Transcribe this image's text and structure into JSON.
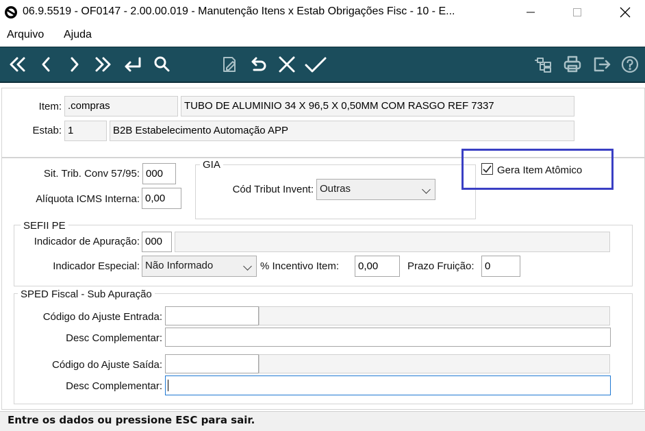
{
  "window": {
    "title": "06.9.5519 - OF0147 - 2.00.00.019 - Manutenção Itens x Estab Obrigações Fisc - 10 - E..."
  },
  "menu": {
    "items": [
      "Arquivo",
      "Ajuda"
    ]
  },
  "toolbar": {
    "icons": [
      "first-icon",
      "prev-icon",
      "next-icon",
      "last-icon",
      "goto-icon",
      "search-icon",
      "edit-icon",
      "undo-icon",
      "cancel-icon",
      "confirm-icon",
      "tree-icon",
      "print-icon",
      "exit-icon",
      "help-icon"
    ]
  },
  "header": {
    "item_label": "Item:",
    "item_code": ".compras",
    "item_desc": "TUBO DE ALUMINIO 34 X 96,5 X 0,50MM COM RASGO REF 7337",
    "estab_label": "Estab:",
    "estab_code": "1",
    "estab_desc": "B2B  Estabelecimento Automação APP"
  },
  "icms": {
    "sit_trib_label": "Sit. Trib. Conv 57/95:",
    "sit_trib_value": "000",
    "aliquota_label": "Alíquota ICMS Interna:",
    "aliquota_value": "0,00"
  },
  "gia": {
    "title": "GIA",
    "cod_tribut_label": "Cód Tribut Invent:",
    "cod_tribut_value": "Outras"
  },
  "gera_item": {
    "label": "Gera Item Atômico",
    "checked": true
  },
  "sefii": {
    "title": "SEFII PE",
    "indicador_apuracao_label": "Indicador de Apuração:",
    "indicador_apuracao_value": "000",
    "indicador_apuracao_desc": "",
    "indicador_especial_label": "Indicador Especial:",
    "indicador_especial_value": "Não Informado",
    "incentivo_label": "% Incentivo Item:",
    "incentivo_value": "0,00",
    "prazo_label": "Prazo Fruição:",
    "prazo_value": "0"
  },
  "sped": {
    "title": "SPED Fiscal - Sub Apuração",
    "ajuste_entrada_label": "Código do Ajuste Entrada:",
    "ajuste_entrada_value": "",
    "desc_entrada_label": "Desc Complementar:",
    "desc_entrada_value": "",
    "ajuste_saida_label": "Código do Ajuste Saída:",
    "ajuste_saida_value": "",
    "desc_saida_label": "Desc Complementar:",
    "desc_saida_value": ""
  },
  "status": {
    "text": "Entre os dados ou pressione ESC para sair."
  },
  "colors": {
    "toolbar_bg": "#1b4d5c",
    "highlight_box": "#3a3fc4",
    "focus_border": "#1e78d2"
  }
}
